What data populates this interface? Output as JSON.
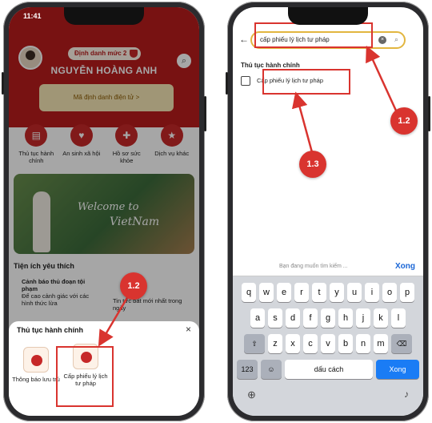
{
  "left": {
    "time": "11:41",
    "badge": "Định danh mức 2",
    "user_name": "NGUYỄN HOÀNG ANH",
    "id_card": "Mã định danh điện tử  >",
    "services": [
      {
        "label": "Thủ tục hành chính",
        "icon": "document-icon"
      },
      {
        "label": "An sinh xã hội",
        "icon": "heart-icon"
      },
      {
        "label": "Hồ sơ sức khỏe",
        "icon": "health-icon"
      },
      {
        "label": "Dịch vụ khác",
        "icon": "star-icon"
      }
    ],
    "banner_line1": "Welcome to",
    "banner_line2": "VietNam",
    "favorites_title": "Tiện ích yêu thích",
    "warn_title": "Cảnh báo thủ đoạn tội phạm",
    "warn_text": "Để cao cảnh giác với các hình thức lừa",
    "warn2": "Tin tức bất mới nhất trong ngày",
    "sheet_title": "Thủ tục hành chính",
    "close": "×",
    "tile1": "Thông báo lưu trú",
    "tile2": "Cấp phiếu lý lịch tư pháp",
    "marker": "1.2"
  },
  "right": {
    "search_value": "cấp phiếu lý lịch tư pháp",
    "section": "Thủ tục hành chính",
    "result": "Cấp phiếu lý lịch tư pháp",
    "marker_a": "1.2",
    "marker_b": "1.3",
    "suggestion": "Bạn đang muốn tìm kiếm ...",
    "done": "Xong",
    "row1": [
      "q",
      "w",
      "e",
      "r",
      "t",
      "y",
      "u",
      "i",
      "o",
      "p"
    ],
    "row2": [
      "a",
      "s",
      "d",
      "f",
      "g",
      "h",
      "j",
      "k",
      "l"
    ],
    "row3": [
      "z",
      "x",
      "c",
      "v",
      "b",
      "n",
      "m"
    ],
    "num": "123",
    "space": "dấu cách",
    "go": "Xong"
  }
}
